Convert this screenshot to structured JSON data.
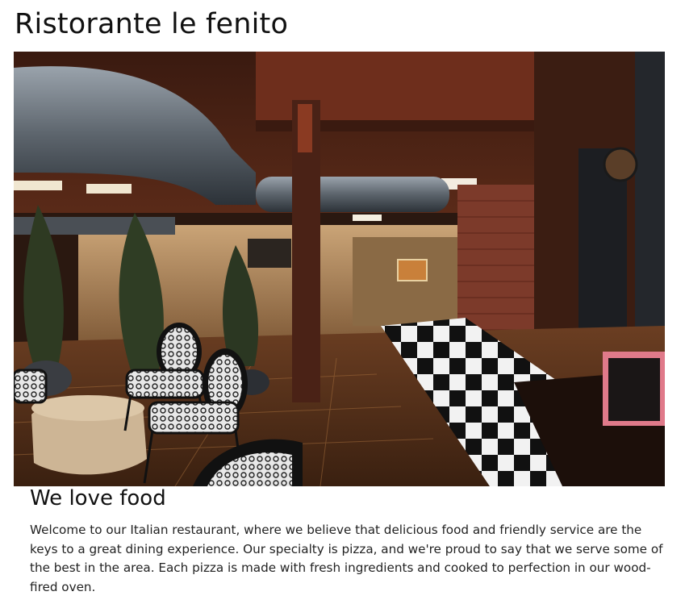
{
  "page": {
    "title": "Ristorante le fenito"
  },
  "hero": {
    "image": "restaurant-interior"
  },
  "about": {
    "heading": "We love food",
    "body": "Welcome to our Italian restaurant, where we believe that delicious food and friendly service are the keys to a great dining experience. Our specialty is pizza, and we're proud to say that we serve some of the best in the area. Each pizza is made with fresh ingredients and cooked to perfection in our wood-fired oven."
  }
}
